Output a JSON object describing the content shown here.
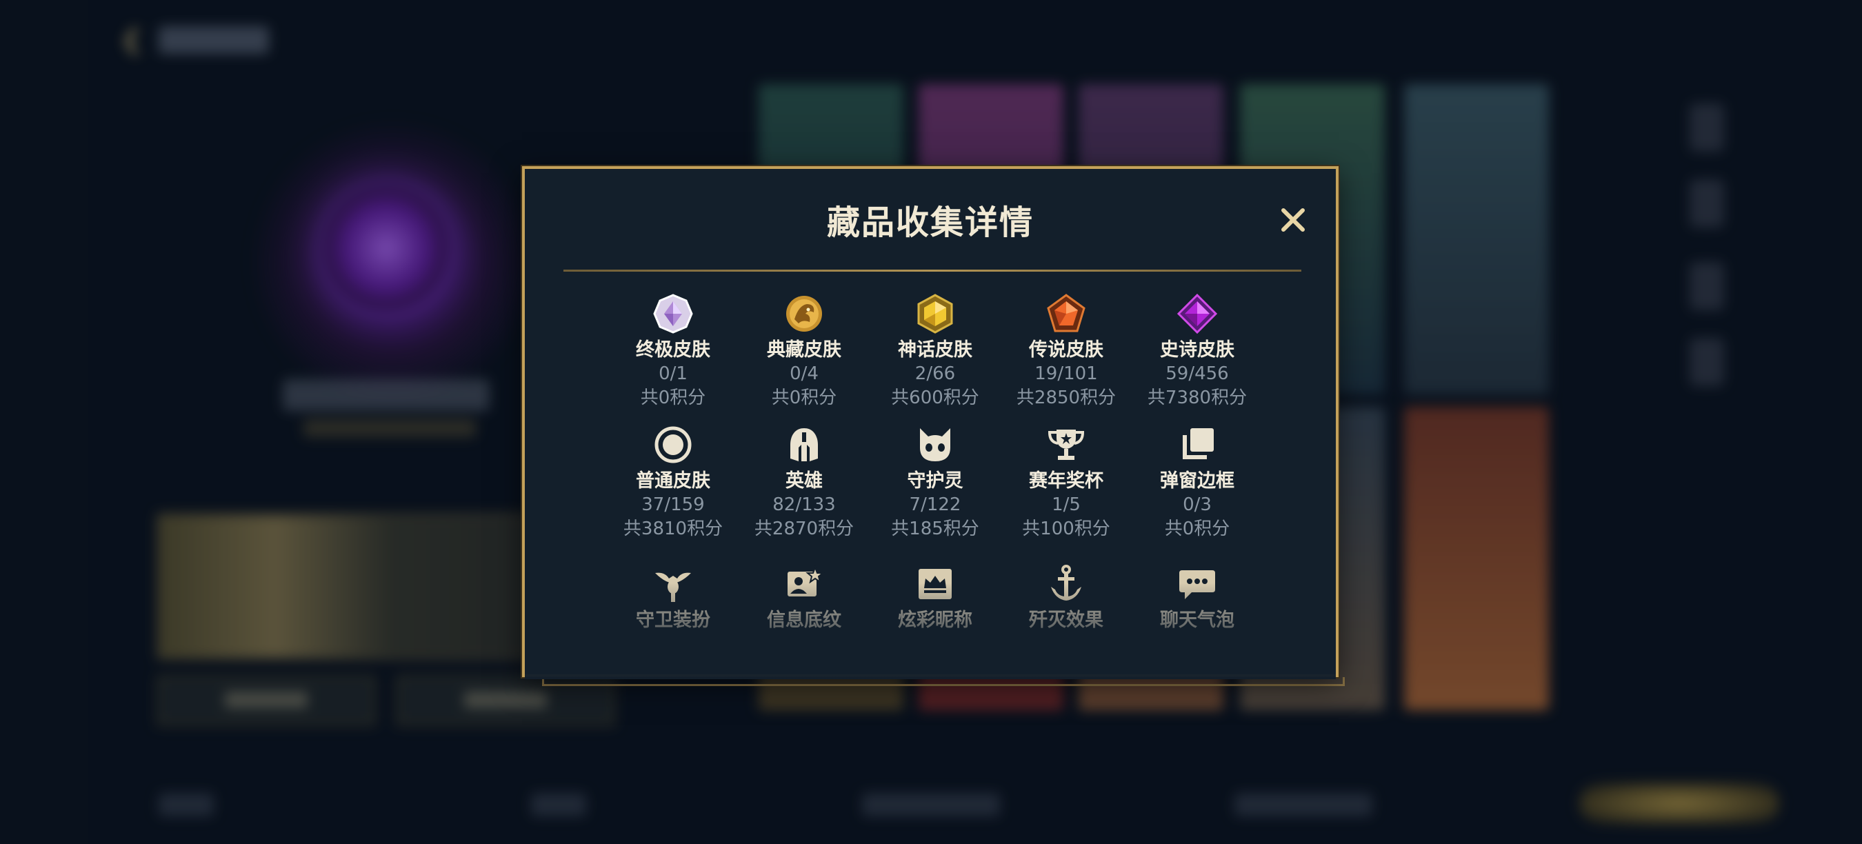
{
  "dialog": {
    "title": "藏品收集详情",
    "close_icon": "close-icon"
  },
  "categories": [
    {
      "label": "终极皮肤",
      "count": "0/1",
      "points": "共0积分",
      "icon": "ultimate-skin-icon"
    },
    {
      "label": "典藏皮肤",
      "count": "0/4",
      "points": "共0积分",
      "icon": "prestige-skin-icon"
    },
    {
      "label": "神话皮肤",
      "count": "2/66",
      "points": "共600积分",
      "icon": "mythic-skin-icon"
    },
    {
      "label": "传说皮肤",
      "count": "19/101",
      "points": "共2850积分",
      "icon": "legendary-skin-icon"
    },
    {
      "label": "史诗皮肤",
      "count": "59/456",
      "points": "共7380积分",
      "icon": "epic-skin-icon"
    },
    {
      "label": "普通皮肤",
      "count": "37/159",
      "points": "共3810积分",
      "icon": "standard-skin-icon"
    },
    {
      "label": "英雄",
      "count": "82/133",
      "points": "共2870积分",
      "icon": "champion-helmet-icon"
    },
    {
      "label": "守护灵",
      "count": "7/122",
      "points": "共185积分",
      "icon": "little-legend-icon"
    },
    {
      "label": "赛年奖杯",
      "count": "1/5",
      "points": "共100积分",
      "icon": "trophy-icon"
    },
    {
      "label": "弹窗边框",
      "count": "0/3",
      "points": "共0积分",
      "icon": "frame-icon"
    },
    {
      "label": "守卫装扮",
      "icon": "ward-skin-icon"
    },
    {
      "label": "信息底纹",
      "icon": "profile-banner-icon"
    },
    {
      "label": "炫彩昵称",
      "icon": "nameplate-crown-icon"
    },
    {
      "label": "歼灭效果",
      "icon": "ace-effect-icon"
    },
    {
      "label": "聊天气泡",
      "icon": "chat-bubble-icon"
    }
  ],
  "colors": {
    "gold_border": "#c4a15a",
    "panel_bg": "#131f2b",
    "label_text": "#f2ecdd",
    "muted_text": "#8b97a3"
  }
}
